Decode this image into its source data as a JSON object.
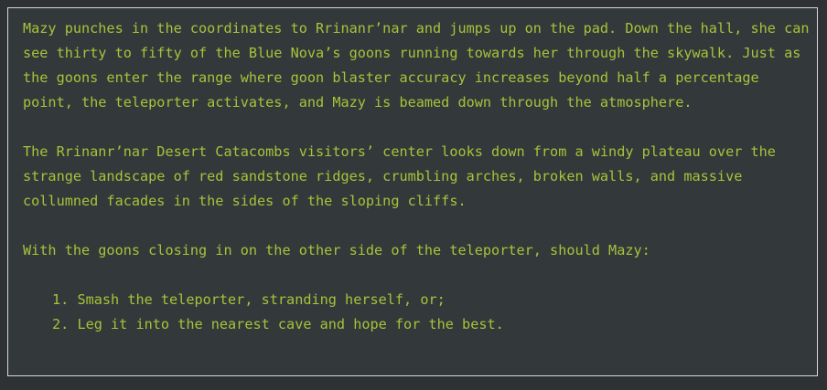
{
  "story": {
    "paragraphs": [
      "Mazy punches in the coordinates to Rrinanr’nar and jumps up on the pad. Down the hall, she can see thirty to fifty of the Blue Nova’s goons running towards her through the skywalk. Just as the goons enter the range where goon blaster accuracy increases beyond half a percentage point, the teleporter activates, and Mazy is beamed down through the atmosphere.",
      "The Rrinanr’nar Desert Catacombs visitors’ center looks down from a windy plateau over the strange landscape of red sandstone ridges, crumbling arches, broken walls, and massive collumned facades in the sides of the sloping cliffs.",
      "With the goons closing in on the other side of the teleporter, should Mazy:"
    ],
    "choices": [
      {
        "number": "1.",
        "text": "Smash the teleporter, stranding herself, or;"
      },
      {
        "number": "2.",
        "text": "Leg it into the nearest cave and hope for the best."
      }
    ]
  },
  "colors": {
    "background": "#33383a",
    "text": "#a8c23a",
    "border": "#d8d8d8"
  }
}
